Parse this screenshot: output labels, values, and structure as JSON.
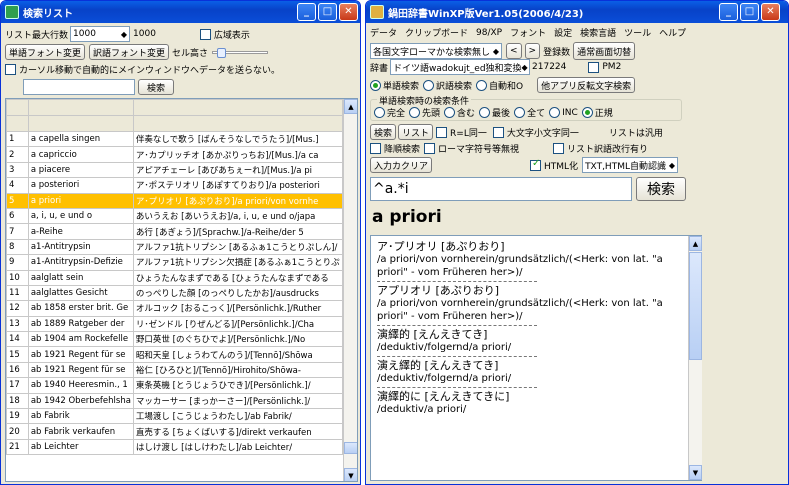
{
  "left": {
    "title": "検索リスト",
    "max_label": "リスト最大行数",
    "max_value": "1000",
    "max_display": "1000",
    "wide_label": "広域表示",
    "word_font_btn": "単語フォント変更",
    "trans_font_btn": "訳語フォント変更",
    "cell_height_label": "セル高さ",
    "cursor_label": "カーソル移動で自動的にメインウィンドウへデータを送らない。",
    "search_btn": "検索",
    "search_value": "",
    "rows": [
      {
        "n": "1",
        "word": "a capella singen",
        "trans": "伴奏なしで歌う [ばんそうなしでうたう]/[Mus.]"
      },
      {
        "n": "2",
        "word": "a capriccio",
        "trans": "ア･カプリッチオ [あかぷりっちお]/[Mus.]/a ca"
      },
      {
        "n": "3",
        "word": "a piacere",
        "trans": "アピアチェーレ [あぴあちぇーれ]/[Mus.]/a pi"
      },
      {
        "n": "4",
        "word": "a posteriori",
        "trans": "ア･ポステリオリ [あぽすてりおり]/a posteriori"
      },
      {
        "n": "5",
        "word": "a priori",
        "trans": "ア･プリオリ [あぷりおり]/a priori/von vornhe"
      },
      {
        "n": "6",
        "word": "a, i, u, e und o",
        "trans": "あいうえお [あいうえお]/a, i, u, e und o/japa"
      },
      {
        "n": "7",
        "word": "a-Reihe",
        "trans": "あ行 [あぎょう]/[Sprachw.]/a-Reihe/der 5"
      },
      {
        "n": "8",
        "word": "a1-Antitrypsin",
        "trans": "アルファ1抗トリプシン [あるふぁ1こうとりぷしん]/"
      },
      {
        "n": "9",
        "word": "a1-Antitrypsin-Defizie",
        "trans": "アルファ1抗トリプシン欠損症 [あるふぁ1こうとりぷ"
      },
      {
        "n": "10",
        "word": "aalglatt sein",
        "trans": "ひょうたんなまずである [ひょうたんなまずである"
      },
      {
        "n": "11",
        "word": "aalglattes Gesicht",
        "trans": "のっぺりした顔 [のっぺりしたかお]/ausdrucks"
      },
      {
        "n": "12",
        "word": "ab 1858 erster brit. Ge",
        "trans": "オルコック [おるこっく]/[Persönlichk.]/Ruther"
      },
      {
        "n": "13",
        "word": "ab 1889 Ratgeber der",
        "trans": "リ･ゼンドル [りぜんどる]/[Persönlichk.]/Cha"
      },
      {
        "n": "14",
        "word": "ab 1904 am Rockefelle",
        "trans": "野口英世 [のぐちひでよ]/[Persönlichk.]/No"
      },
      {
        "n": "15",
        "word": "ab 1921 Regent für se",
        "trans": "昭和天皇 [しょうわてんのう]/[Tennō]/Shōwa"
      },
      {
        "n": "16",
        "word": "ab 1921 Regent für se",
        "trans": "裕仁 [ひろひと]/[Tennō]/Hirohito/Shōwa-"
      },
      {
        "n": "17",
        "word": "ab 1940 Heeresmin., 1",
        "trans": "東条英機 [とうじょうひでき]/[Persönlichk.]/"
      },
      {
        "n": "18",
        "word": "ab 1942 Oberbefehlsha",
        "trans": "マッカーサー [まっかーさー]/[Persönlichk.]/"
      },
      {
        "n": "19",
        "word": "ab Fabrik",
        "trans": "工場渡し [こうじょうわたし]/ab Fabrik/"
      },
      {
        "n": "20",
        "word": "ab Fabrik verkaufen",
        "trans": "直売する [ちょくばいする]/direkt verkaufen"
      },
      {
        "n": "21",
        "word": "ab Leichter",
        "trans": "はしけ渡し [はしけわたし]/ab Leichter/"
      }
    ]
  },
  "right": {
    "title": "鍋田辞書WinXP版Ver1.05(2006/4/23)",
    "menu": [
      "データ",
      "クリップボード",
      "98/XP",
      "フォント",
      "設定",
      "検索言語",
      "ツール",
      "ヘルプ"
    ],
    "lang_combo": "各国文字ローマかな検索無し",
    "reg_label": "登録数",
    "reg_count": "217224",
    "normal_btn": "通常画面切替",
    "dict_label": "辞書",
    "dict_combo": "ドイツ語wadokujt_ed独和変換",
    "pm2_label": "PM2",
    "radios1": [
      "単語検索",
      "訳語検索",
      "自動和O"
    ],
    "other_btn": "他アプリ反転文字検索",
    "cond_legend": "単語検索時の検索条件",
    "radios2": [
      "完全",
      "先頭",
      "含む",
      "最後",
      "全て",
      "INC",
      "正規"
    ],
    "search_btn": "検索",
    "list_btn": "リスト",
    "r_l_same": "R=L同一",
    "case_label": "大文字小文字同一",
    "list_use": "リストは汎用",
    "desc_label": "降順検索",
    "roman_label": "ローマ字符号等無視",
    "list_trans": "リスト訳語改行有り",
    "input_help": "入力カクリア",
    "html_label": "HTML化",
    "html_combo": "TXT,HTML自動認識",
    "query": "^a.*i",
    "big_search": "検索",
    "headword": "a priori",
    "entries": [
      "ア･プリオリ [あぷりおり]",
      "/a priori/von vornherein/grundsätzlich/(<Herk: von lat. \"a priori\" - vom Früheren her>)/",
      "アプリオリ [あぷりおり]",
      "/a priori/von vornherein/grundsätzlich/(<Herk: von lat. \"a priori\" - vom Früheren her>)/",
      "演繹的 [えんえきてき]",
      "/deduktiv/folgernd/a priori/",
      "演え繹的 [えんえきてき]",
      "/deduktiv/folgernd/a priori/",
      "演繹的に [えんえきてきに]",
      "/deduktiv/a priori/"
    ]
  }
}
